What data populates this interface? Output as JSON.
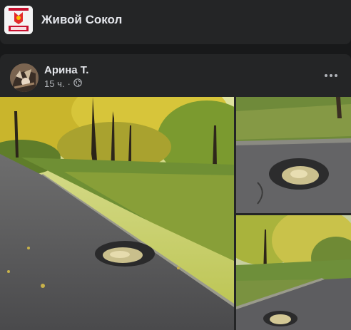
{
  "group": {
    "name": "Живой Сокол",
    "avatar_icon": "group-logo-icon"
  },
  "post": {
    "author": "Арина Т.",
    "time": "15 ч.",
    "separator": "·",
    "audience_icon": "globe-icon",
    "menu_icon": "more-options-icon",
    "photos": [
      {
        "id": "photo-1",
        "subject": "park asphalt path with pothole and autumn trees"
      },
      {
        "id": "photo-2",
        "subject": "close-up pothole with leaves"
      },
      {
        "id": "photo-3",
        "subject": "park path with pothole, yellow trees"
      }
    ]
  },
  "colors": {
    "page_bg": "#18191a",
    "card_bg": "#242526",
    "text_primary": "#e4e6eb",
    "text_secondary": "#b0b3b8"
  }
}
